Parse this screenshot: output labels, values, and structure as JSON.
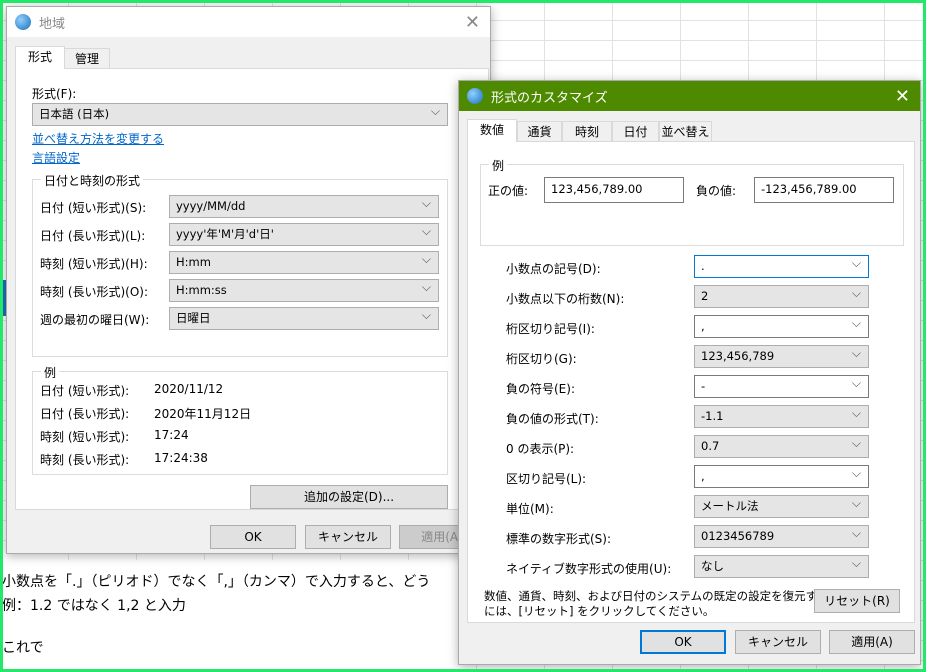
{
  "background": {
    "lines": [
      "小数点を「.」（ピリオド）でなく「,」（カンマ）で入力すると、どう",
      "例：1.2 ではなく 1,2 と入力",
      "これで"
    ]
  },
  "region": {
    "title": "地域",
    "tabs": [
      "形式",
      "管理"
    ],
    "format_label": "形式(F):",
    "format_value": "日本語 (日本)",
    "links": [
      "並べ替え方法を変更する",
      "言語設定"
    ],
    "datetime_group": "日付と時刻の形式",
    "rows": [
      {
        "label": "日付 (短い形式)(S):",
        "value": "yyyy/MM/dd"
      },
      {
        "label": "日付 (長い形式)(L):",
        "value": "yyyy'年'M'月'd'日'"
      },
      {
        "label": "時刻 (短い形式)(H):",
        "value": "H:mm"
      },
      {
        "label": "時刻 (長い形式)(O):",
        "value": "H:mm:ss"
      },
      {
        "label": "週の最初の曜日(W):",
        "value": "日曜日"
      }
    ],
    "example_group": "例",
    "examples": [
      {
        "label": "日付 (短い形式):",
        "value": "2020/11/12"
      },
      {
        "label": "日付 (長い形式):",
        "value": "2020年11月12日"
      },
      {
        "label": "時刻 (短い形式):",
        "value": "17:24"
      },
      {
        "label": "時刻 (長い形式):",
        "value": "17:24:38"
      }
    ],
    "additional": "追加の設定(D)...",
    "ok": "OK",
    "cancel": "キャンセル",
    "apply": "適用(A)"
  },
  "custom": {
    "title": "形式のカスタマイズ",
    "title_color": "#4d8a00",
    "tabs": [
      "数値",
      "通貨",
      "時刻",
      "日付",
      "並べ替え"
    ],
    "example_group": "例",
    "positive_label": "正の値:",
    "positive_value": "123,456,789.00",
    "negative_label": "負の値:",
    "negative_value": "-123,456,789.00",
    "rows": [
      {
        "label": "小数点の記号(D):",
        "value": "."
      },
      {
        "label": "小数点以下の桁数(N):",
        "value": "2"
      },
      {
        "label": "桁区切り記号(I):",
        "value": ","
      },
      {
        "label": "桁区切り(G):",
        "value": "123,456,789"
      },
      {
        "label": "負の符号(E):",
        "value": "-"
      },
      {
        "label": "負の値の形式(T):",
        "value": "-1.1"
      },
      {
        "label": "0 の表示(P):",
        "value": "0.7"
      },
      {
        "label": "区切り記号(L):",
        "value": ","
      },
      {
        "label": "単位(M):",
        "value": "メートル法"
      },
      {
        "label": "標準の数字形式(S):",
        "value": "0123456789"
      },
      {
        "label": "ネイティブ数字形式の使用(U):",
        "value": "なし"
      }
    ],
    "reset_text_1": "数値、通貨、時刻、および日付のシステムの既定の設定を復元する",
    "reset_text_2": "には、[リセット] をクリックしてください。",
    "reset": "リセット(R)",
    "ok": "OK",
    "cancel": "キャンセル",
    "apply": "適用(A)"
  }
}
